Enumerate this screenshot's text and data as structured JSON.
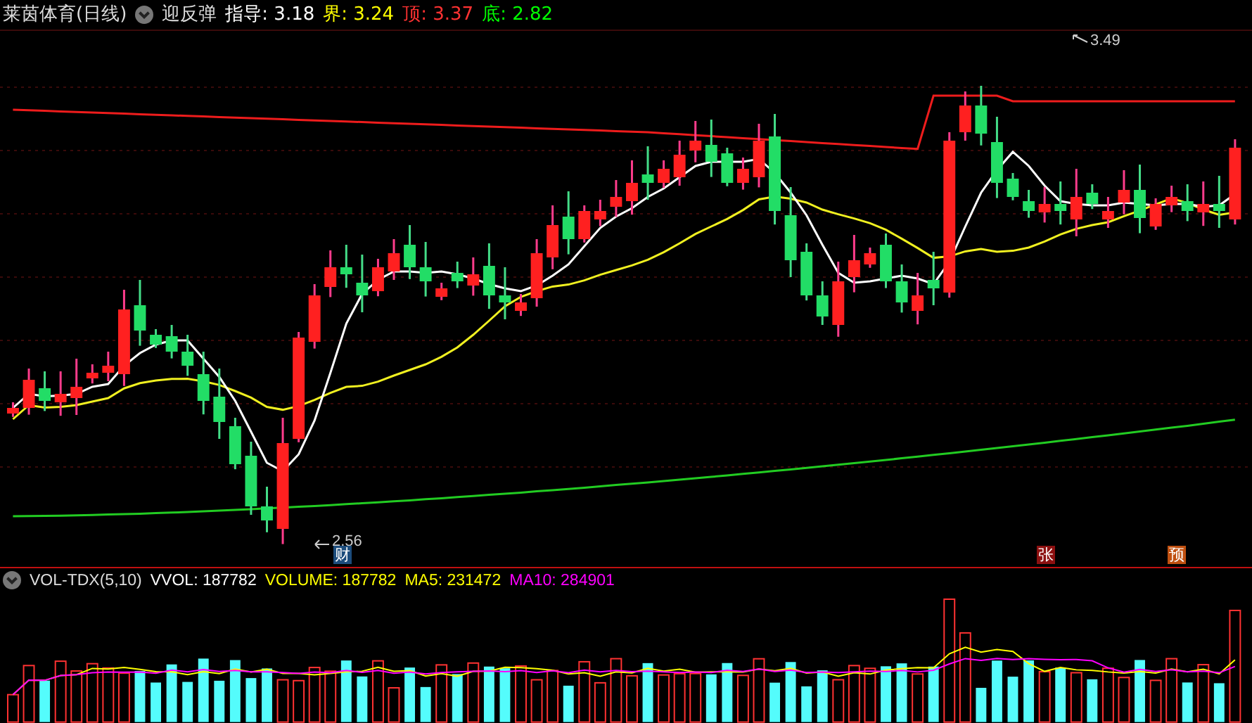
{
  "header": {
    "title": "莱茵体育(日线)",
    "indicator": "迎反弹",
    "readings": [
      {
        "text": "指导: 3.18",
        "color": "#ffffff"
      },
      {
        "text": "界: 3.24",
        "color": "#ffff00"
      },
      {
        "text": "顶: 3.37",
        "color": "#ff3232"
      },
      {
        "text": "底: 2.82",
        "color": "#00ff00"
      }
    ]
  },
  "price_chart": {
    "high_label": "3.49",
    "low_label": "2.56",
    "events": [
      {
        "text": "财",
        "color": "#1c4c7c"
      },
      {
        "text": "张",
        "color": "#8c1010"
      },
      {
        "text": "预",
        "color": "#c05010"
      }
    ]
  },
  "volume_panel": {
    "indicator": "VOL-TDX(5,10)",
    "readings": [
      {
        "text": "VVOL: 187782",
        "color": "#ffffff"
      },
      {
        "text": "VOLUME: 187782",
        "color": "#ffff00"
      },
      {
        "text": "MA5: 231472",
        "color": "#ffff00"
      },
      {
        "text": "MA10: 284901",
        "color": "#ff00ff"
      }
    ]
  }
}
